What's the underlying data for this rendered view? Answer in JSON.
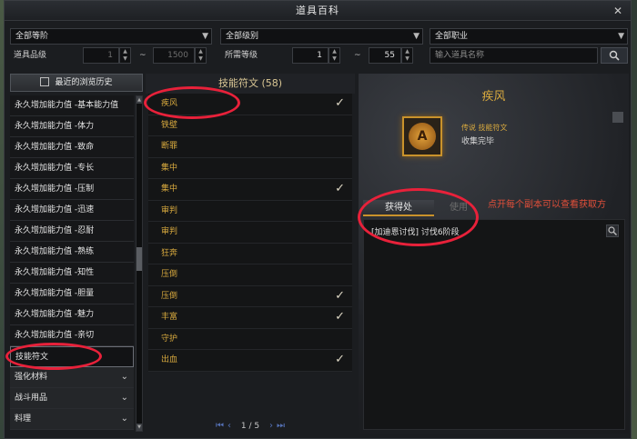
{
  "window": {
    "title": "道具百科"
  },
  "filters": {
    "tier_select": "全部等阶",
    "grade_select": "全部级别",
    "class_select": "全部职业",
    "item_grade_label": "道具品级",
    "item_grade_min": "1",
    "item_grade_max": "1500",
    "level_label": "所需等级",
    "level_min": "1",
    "level_max": "55",
    "tilde": "~",
    "search_placeholder": "输入道具名称"
  },
  "sidebar": {
    "history_label": "最近的浏览历史",
    "items": [
      "永久增加能力值 -基本能力值",
      "永久增加能力值 -体力",
      "永久增加能力值 -致命",
      "永久增加能力值 -专长",
      "永久增加能力值 -压制",
      "永久增加能力值 -迅速",
      "永久增加能力值 -忍耐",
      "永久增加能力值 -熟练",
      "永久增加能力值 -知性",
      "永久增加能力值 -胆量",
      "永久增加能力值 -魅力",
      "永久增加能力值 -亲切",
      "技能符文"
    ],
    "groups": [
      "强化材料",
      "战斗用品",
      "料理"
    ]
  },
  "rune_list": {
    "header": "技能符文 (58)",
    "items": [
      {
        "name": "疾风",
        "checked": true
      },
      {
        "name": "铁壁",
        "checked": false
      },
      {
        "name": "断罪",
        "checked": false
      },
      {
        "name": "集中",
        "checked": false
      },
      {
        "name": "集中",
        "checked": true
      },
      {
        "name": "审判",
        "checked": false
      },
      {
        "name": "审判",
        "checked": false
      },
      {
        "name": "狂奔",
        "checked": false
      },
      {
        "name": "压倒",
        "checked": false
      },
      {
        "name": "压倒",
        "checked": true
      },
      {
        "name": "丰富",
        "checked": true
      },
      {
        "name": "守护",
        "checked": false
      },
      {
        "name": "出血",
        "checked": true
      }
    ],
    "page": "1 / 5"
  },
  "detail": {
    "title": "疾风",
    "type_text": "传说 技能符文",
    "status_text": "收集完毕",
    "tab_active": "获得处",
    "tab_inactive": "使用",
    "source_entry": "[加迪恩讨伐] 讨伐6阶段"
  },
  "annotation": {
    "note": "点开每个副本可以查看获取方"
  },
  "colors": {
    "accent_gold": "#d8a93e",
    "annotation_red": "#e8213a"
  }
}
